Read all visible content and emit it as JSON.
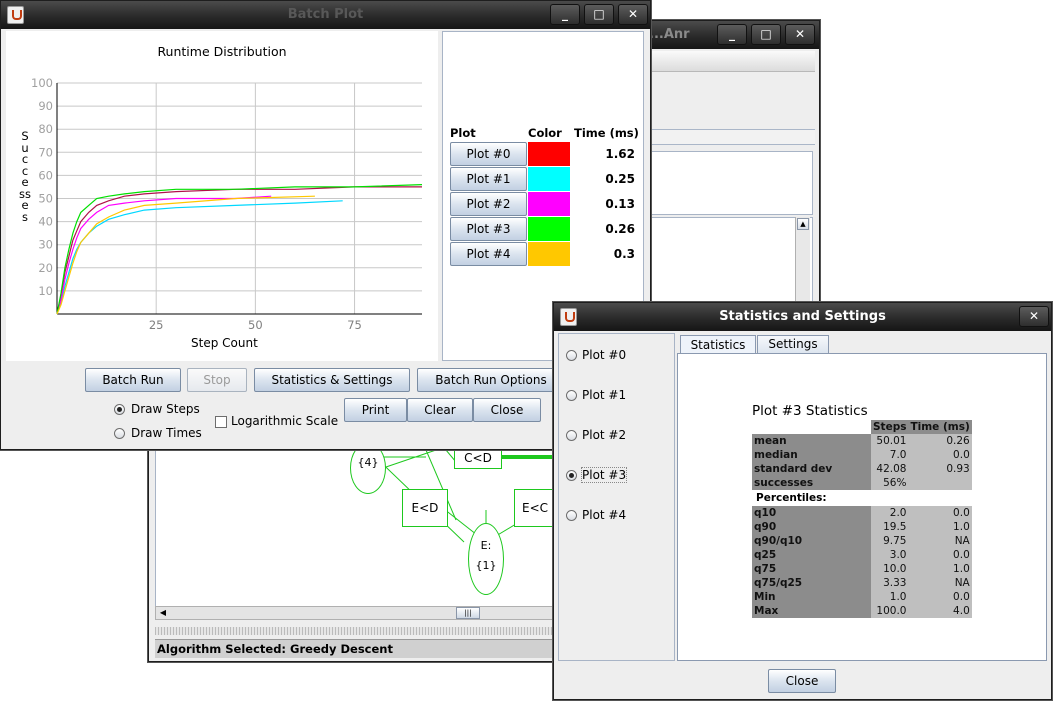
{
  "back_window": {
    "title": "...Anr",
    "status_label": "Algorithm Selected:",
    "status_value": "Greedy Descent",
    "graph_nodes": {
      "node_four": "{4}",
      "c_lt_d": "C<D",
      "e_lt_d": "E<D",
      "e_lt_c": "E<C",
      "node_e_label": "E:",
      "node_e_value": "{1}"
    }
  },
  "batch_plot": {
    "title": "Batch Plot",
    "chart_title": "Runtime Distribution",
    "buttons": {
      "batch_run": "Batch Run",
      "stop": "Stop",
      "stats_settings": "Statistics & Settings",
      "batch_run_options": "Batch Run Options",
      "print": "Print",
      "clear": "Clear",
      "close": "Close"
    },
    "options": {
      "draw_steps": "Draw Steps",
      "draw_times": "Draw Times",
      "log_scale": "Logarithmic Scale"
    },
    "legend": {
      "headers": [
        "Plot",
        "Color",
        "Time (ms)"
      ],
      "rows": [
        {
          "label": "Plot #0",
          "color": "#ff0000",
          "time": "1.62"
        },
        {
          "label": "Plot #1",
          "color": "#00ffff",
          "time": "0.25"
        },
        {
          "label": "Plot #2",
          "color": "#ff00ff",
          "time": "0.13"
        },
        {
          "label": "Plot #3",
          "color": "#00ff00",
          "time": "0.26"
        },
        {
          "label": "Plot #4",
          "color": "#ffc800",
          "time": "0.3"
        }
      ]
    }
  },
  "chart_data": {
    "type": "line",
    "title": "Runtime Distribution",
    "xlabel": "Step Count",
    "ylabel": "Successes",
    "xlim": [
      0,
      92
    ],
    "ylim": [
      0,
      100
    ],
    "x_ticks": [
      "25",
      "50",
      "75"
    ],
    "y_ticks": [
      "10",
      "20",
      "30",
      "40",
      "50",
      "60",
      "70",
      "80",
      "90",
      "100"
    ],
    "grid": true,
    "series": [
      {
        "name": "Plot #0",
        "color": "#b0104a",
        "points": [
          [
            0,
            0
          ],
          [
            1,
            8
          ],
          [
            2,
            18
          ],
          [
            3,
            25
          ],
          [
            4,
            32
          ],
          [
            5,
            36
          ],
          [
            6,
            40
          ],
          [
            8,
            44
          ],
          [
            10,
            47
          ],
          [
            13,
            49
          ],
          [
            17,
            51
          ],
          [
            22,
            52
          ],
          [
            30,
            53
          ],
          [
            45,
            54
          ],
          [
            60,
            54
          ],
          [
            75,
            55
          ],
          [
            92,
            55
          ]
        ]
      },
      {
        "name": "Plot #1",
        "color": "#00d8ff",
        "points": [
          [
            0,
            0
          ],
          [
            1,
            5
          ],
          [
            2,
            12
          ],
          [
            3,
            18
          ],
          [
            4,
            24
          ],
          [
            5,
            28
          ],
          [
            6,
            31
          ],
          [
            8,
            35
          ],
          [
            10,
            38
          ],
          [
            13,
            41
          ],
          [
            17,
            43
          ],
          [
            22,
            45
          ],
          [
            30,
            46
          ],
          [
            45,
            47
          ],
          [
            60,
            48
          ],
          [
            72,
            49
          ]
        ]
      },
      {
        "name": "Plot #2",
        "color": "#ff00ff",
        "points": [
          [
            0,
            0
          ],
          [
            1,
            6
          ],
          [
            2,
            15
          ],
          [
            3,
            22
          ],
          [
            4,
            28
          ],
          [
            5,
            33
          ],
          [
            6,
            37
          ],
          [
            8,
            41
          ],
          [
            10,
            44
          ],
          [
            13,
            47
          ],
          [
            17,
            48
          ],
          [
            22,
            49
          ],
          [
            30,
            50
          ],
          [
            45,
            50
          ],
          [
            54,
            51
          ]
        ]
      },
      {
        "name": "Plot #3",
        "color": "#00e000",
        "points": [
          [
            0,
            0
          ],
          [
            1,
            9
          ],
          [
            2,
            20
          ],
          [
            3,
            28
          ],
          [
            4,
            35
          ],
          [
            5,
            40
          ],
          [
            6,
            44
          ],
          [
            8,
            47
          ],
          [
            10,
            50
          ],
          [
            13,
            51
          ],
          [
            17,
            52
          ],
          [
            22,
            53
          ],
          [
            30,
            54
          ],
          [
            45,
            54
          ],
          [
            60,
            55
          ],
          [
            75,
            55
          ],
          [
            92,
            56
          ]
        ]
      },
      {
        "name": "Plot #4",
        "color": "#ffc800",
        "points": [
          [
            0,
            0
          ],
          [
            1,
            4
          ],
          [
            2,
            10
          ],
          [
            3,
            16
          ],
          [
            4,
            22
          ],
          [
            5,
            27
          ],
          [
            6,
            31
          ],
          [
            8,
            35
          ],
          [
            10,
            39
          ],
          [
            13,
            42
          ],
          [
            17,
            45
          ],
          [
            22,
            47
          ],
          [
            30,
            48
          ],
          [
            45,
            50
          ],
          [
            65,
            51
          ]
        ]
      }
    ]
  },
  "stats_window": {
    "title": "Statistics and Settings",
    "plots": [
      "Plot #0",
      "Plot #1",
      "Plot #2",
      "Plot #3",
      "Plot #4"
    ],
    "selected_plot": "Plot #3",
    "tabs": [
      "Statistics",
      "Settings"
    ],
    "heading": "Plot #3 Statistics",
    "columns": [
      "Steps",
      "Time (ms)"
    ],
    "rows": [
      {
        "k": "mean",
        "a": "50.01",
        "b": "0.26"
      },
      {
        "k": "median",
        "a": "7.0",
        "b": "0.0"
      },
      {
        "k": "standard dev",
        "a": "42.08",
        "b": "0.93"
      },
      {
        "k": "successes",
        "a": "56%",
        "b": ""
      }
    ],
    "percentiles_label": "Percentiles:",
    "percentiles": [
      {
        "k": "q10",
        "a": "2.0",
        "b": "0.0"
      },
      {
        "k": "q90",
        "a": "19.5",
        "b": "1.0"
      },
      {
        "k": "q90/q10",
        "a": "9.75",
        "b": "NA"
      },
      {
        "k": "q25",
        "a": "3.0",
        "b": "0.0"
      },
      {
        "k": "q75",
        "a": "10.0",
        "b": "1.0"
      },
      {
        "k": "q75/q25",
        "a": "3.33",
        "b": "NA"
      },
      {
        "k": "Min",
        "a": "1.0",
        "b": "0.0"
      },
      {
        "k": "Max",
        "a": "100.0",
        "b": "4.0"
      }
    ],
    "close_label": "Close"
  }
}
